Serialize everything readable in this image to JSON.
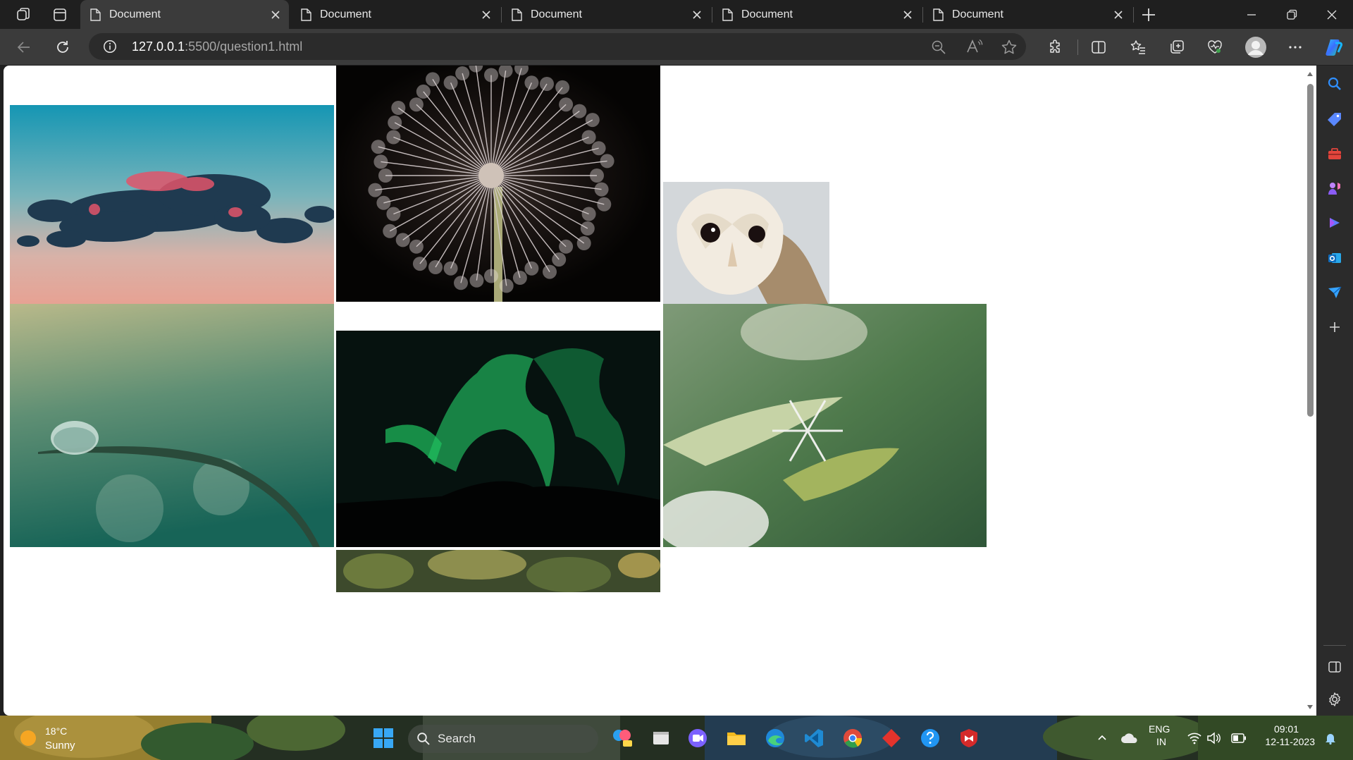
{
  "browser": {
    "tabs": [
      {
        "label": "Document",
        "active": true
      },
      {
        "label": "Document",
        "active": false
      },
      {
        "label": "Document",
        "active": false
      },
      {
        "label": "Document",
        "active": false
      },
      {
        "label": "Document",
        "active": false
      }
    ],
    "address": {
      "host": "127.0.0.1",
      "path": ":5500/question1.html"
    }
  },
  "page": {
    "images": [
      {
        "subject": "clouds at sunset"
      },
      {
        "subject": "dandelion seed head"
      },
      {
        "subject": "barn owl"
      },
      {
        "subject": "water droplet on grass blade"
      },
      {
        "subject": "aurora borealis"
      },
      {
        "subject": "snowflake on leaf"
      },
      {
        "subject": "tree canopy"
      }
    ],
    "scroll_position": 0.0
  },
  "sidebar": {
    "icons": [
      "search-icon",
      "tag-icon",
      "toolbox-icon",
      "games-icon",
      "copilot-app-icon",
      "outlook-icon",
      "send-icon",
      "add-icon",
      "split-panel-icon",
      "settings-icon"
    ]
  },
  "taskbar": {
    "weather": {
      "temperature": "18°C",
      "condition": "Sunny"
    },
    "search_placeholder": "Search",
    "language": {
      "lang": "ENG",
      "region": "IN"
    },
    "time": "09:01",
    "date": "12-11-2023"
  },
  "colors": {
    "tab_strip": "#1f1f1f",
    "toolbar": "#3b3b3b",
    "omnibox": "#2b2b2b",
    "page_background": "#ffffff"
  }
}
